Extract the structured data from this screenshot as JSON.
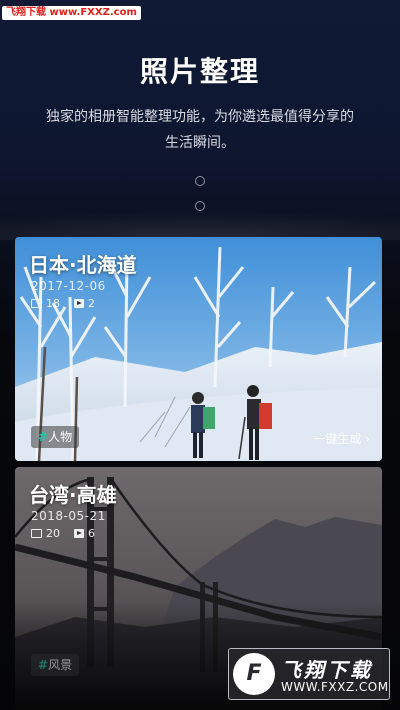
{
  "watermark_top": "飞翔下载 www.FXXZ.com",
  "header": {
    "title": "照片整理",
    "description": "独家的相册智能整理功能，为你遴选最值得分享的生活瞬间。"
  },
  "pager": {
    "count": 2
  },
  "cards": [
    {
      "title": "日本·北海道",
      "date": "2017-12-06",
      "photo_count": "18",
      "video_count": "2",
      "tag_hash": "#",
      "tag_label": "人物",
      "action_label": "一键生成 ›"
    },
    {
      "title": "台湾·高雄",
      "date": "2018-05-21",
      "photo_count": "20",
      "video_count": "6",
      "tag_hash": "#",
      "tag_label": "风景"
    }
  ],
  "watermark_bottom": {
    "logo_letter": "F",
    "brand": "飞翔下载",
    "url": "WWW.FXXZ.COM"
  },
  "colors": {
    "accent_tag": "#27c2a8",
    "watermark_red": "#e0201c",
    "background": "#0b0d14"
  },
  "icons": [
    "photo-count-icon",
    "video-count-icon",
    "chevron-right-icon"
  ]
}
